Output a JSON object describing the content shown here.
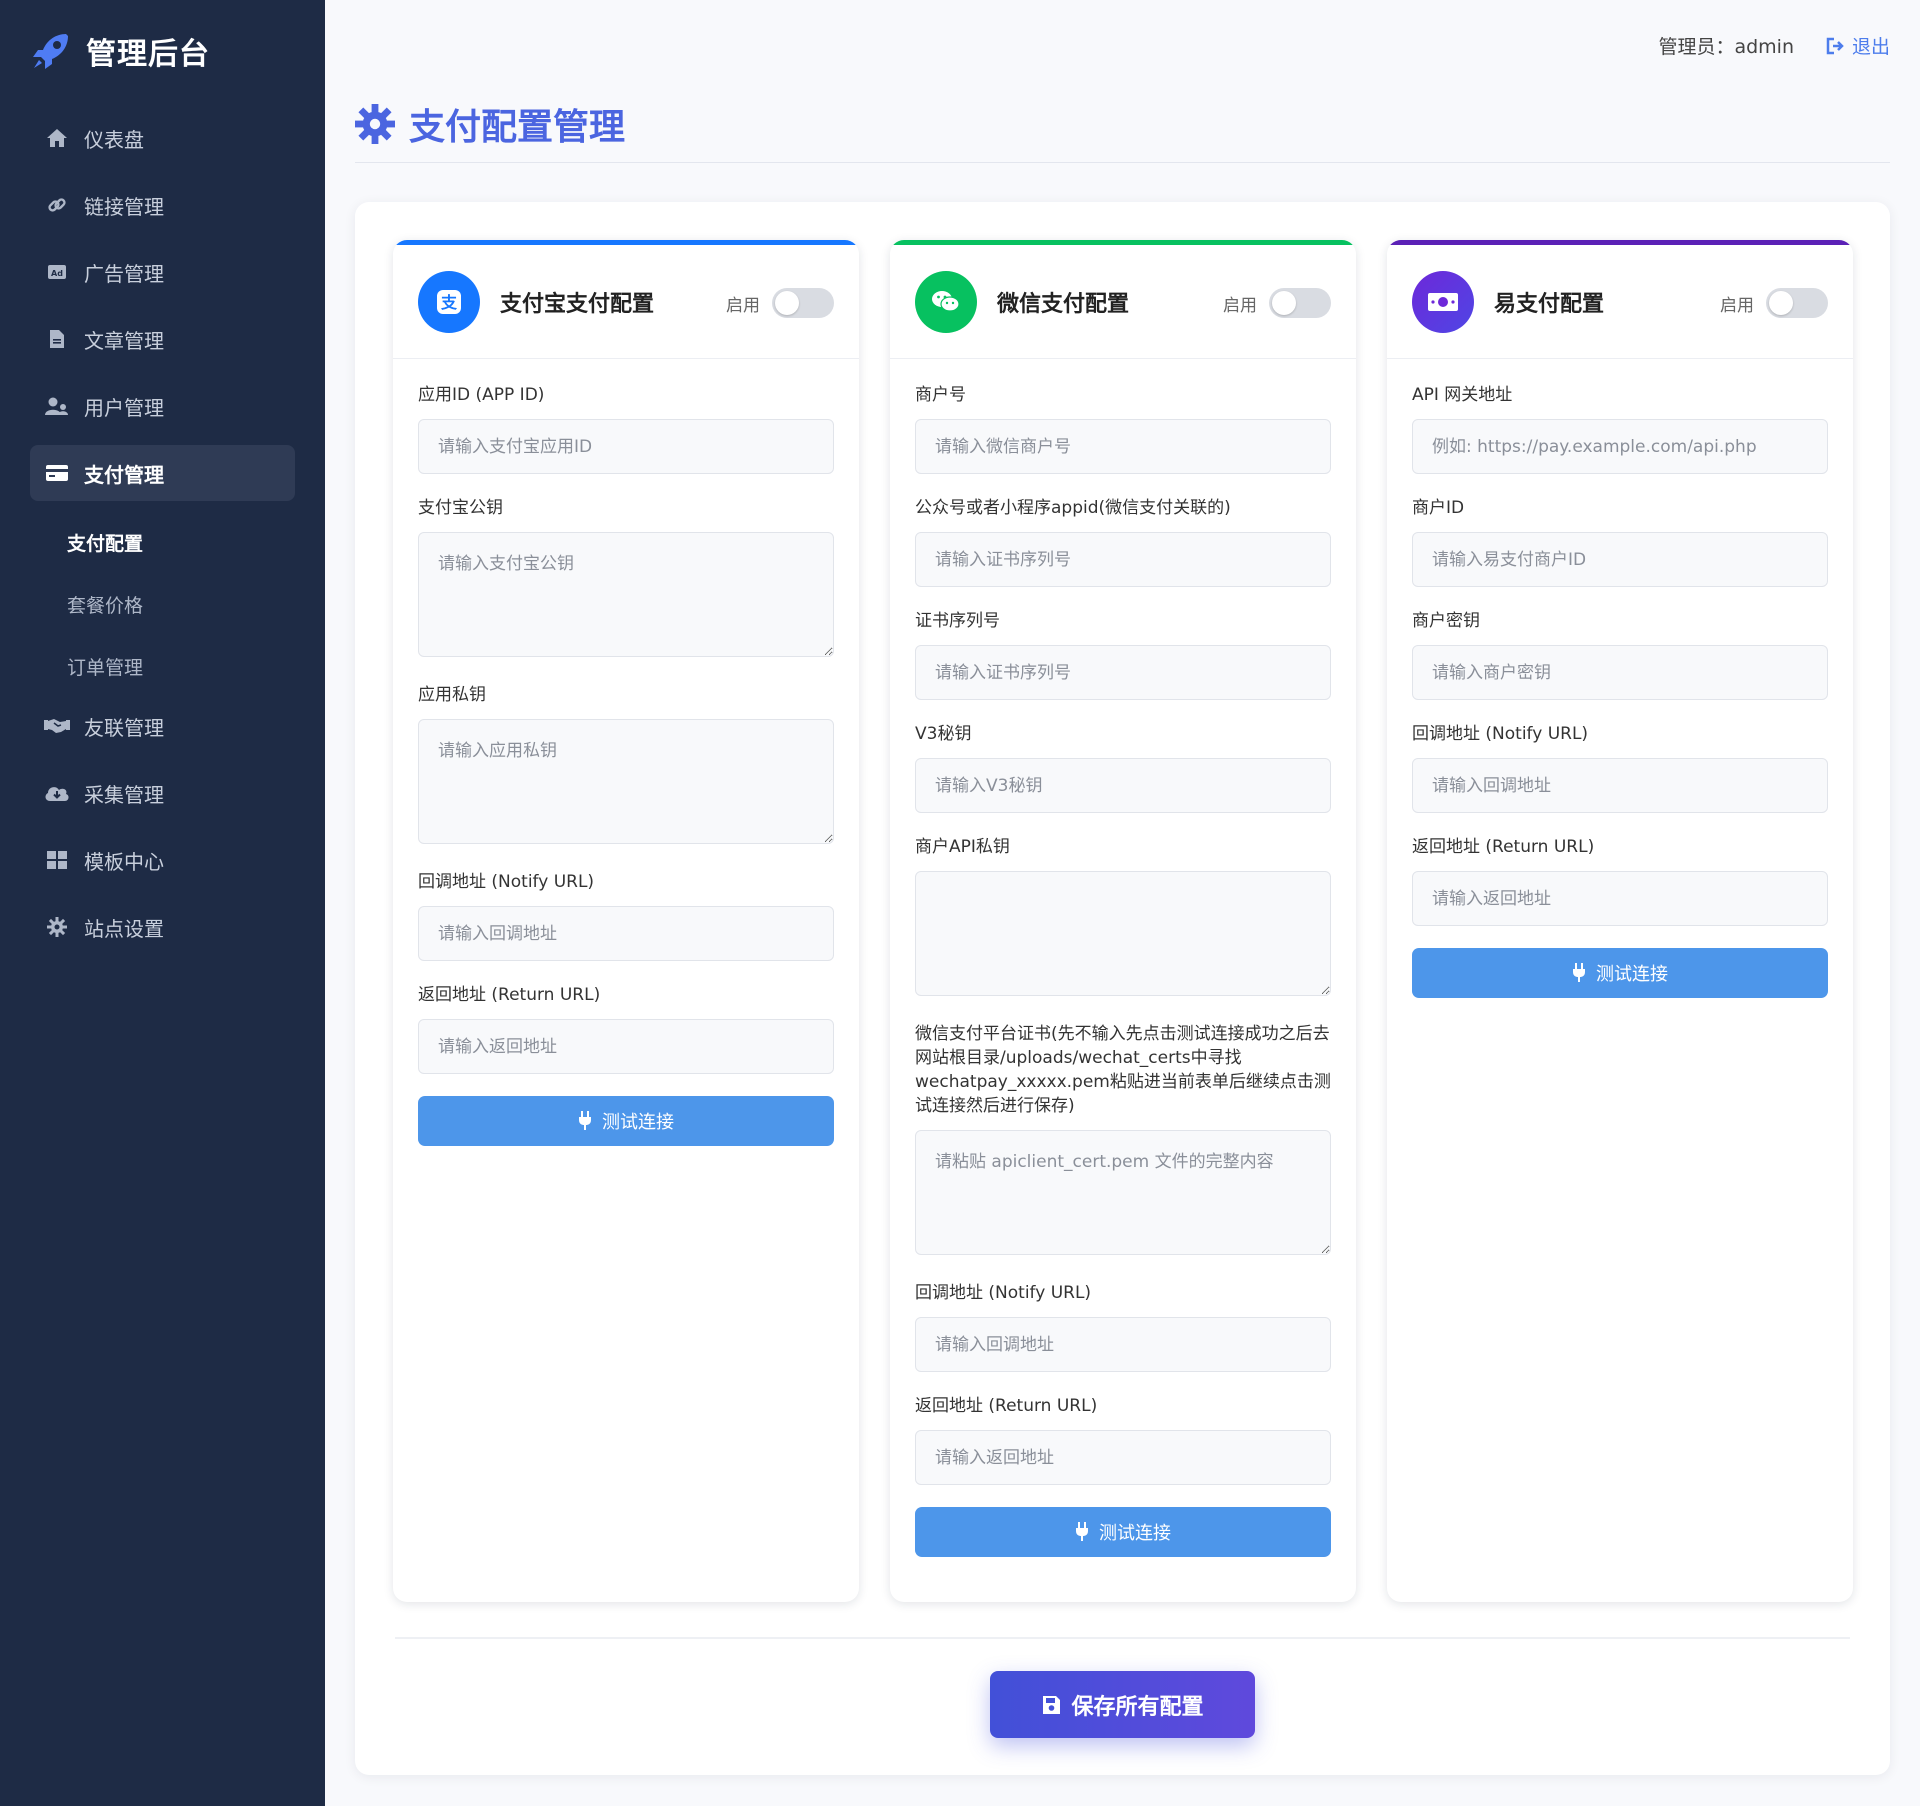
{
  "brand": {
    "title": "管理后台"
  },
  "sidebar": {
    "items": [
      {
        "label": "仪表盘",
        "icon": "home-icon"
      },
      {
        "label": "链接管理",
        "icon": "link-icon"
      },
      {
        "label": "广告管理",
        "icon": "ad-icon"
      },
      {
        "label": "文章管理",
        "icon": "file-icon"
      },
      {
        "label": "用户管理",
        "icon": "users-icon"
      },
      {
        "label": "支付管理",
        "icon": "credit-card-icon"
      },
      {
        "label": "友联管理",
        "icon": "handshake-icon"
      },
      {
        "label": "采集管理",
        "icon": "cloud-download-icon"
      },
      {
        "label": "模板中心",
        "icon": "grid-icon"
      },
      {
        "label": "站点设置",
        "icon": "gear-icon"
      }
    ],
    "sub_items": [
      {
        "label": "支付配置"
      },
      {
        "label": "套餐价格"
      },
      {
        "label": "订单管理"
      }
    ]
  },
  "header": {
    "user": "管理员：admin",
    "logout": "退出"
  },
  "page": {
    "title": "支付配置管理"
  },
  "cards": {
    "alipay": {
      "title": "支付宝支付配置",
      "toggle_label": "启用",
      "enabled": false,
      "accent": "#1677ff",
      "fields": [
        {
          "label": "应用ID (APP ID)",
          "placeholder": "请输入支付宝应用ID"
        },
        {
          "label": "支付宝公钥",
          "placeholder": "请输入支付宝公钥"
        },
        {
          "label": "应用私钥",
          "placeholder": "请输入应用私钥"
        },
        {
          "label": "回调地址 (Notify URL)",
          "placeholder": "请输入回调地址"
        },
        {
          "label": "返回地址 (Return URL)",
          "placeholder": "请输入返回地址"
        }
      ],
      "test_button": "测试连接"
    },
    "wechat": {
      "title": "微信支付配置",
      "toggle_label": "启用",
      "enabled": false,
      "accent": "#07c160",
      "fields": [
        {
          "label": "商户号",
          "placeholder": "请输入微信商户号"
        },
        {
          "label": "公众号或者小程序appid(微信支付关联的)",
          "placeholder": "请输入证书序列号"
        },
        {
          "label": "证书序列号",
          "placeholder": "请输入证书序列号"
        },
        {
          "label": "V3秘钥",
          "placeholder": "请输入V3秘钥"
        },
        {
          "label": "商户API私钥",
          "placeholder": ""
        },
        {
          "label": "微信支付平台证书(先不输入先点击测试连接成功之后去网站根目录/uploads/wechat_certs中寻找wechatpay_xxxxx.pem粘贴进当前表单后继续点击测试连接然后进行保存)",
          "placeholder": "请粘贴 apiclient_cert.pem 文件的完整内容"
        },
        {
          "label": "回调地址 (Notify URL)",
          "placeholder": "请输入回调地址"
        },
        {
          "label": "返回地址 (Return URL)",
          "placeholder": "请输入返回地址"
        }
      ],
      "test_button": "测试连接"
    },
    "epay": {
      "title": "易支付配置",
      "toggle_label": "启用",
      "enabled": false,
      "accent": "#5b21b6",
      "fields": [
        {
          "label": "API 网关地址",
          "placeholder": "例如: https://pay.example.com/api.php"
        },
        {
          "label": "商户ID",
          "placeholder": "请输入易支付商户ID"
        },
        {
          "label": "商户密钥",
          "placeholder": "请输入商户密钥"
        },
        {
          "label": "回调地址 (Notify URL)",
          "placeholder": "请输入回调地址"
        },
        {
          "label": "返回地址 (Return URL)",
          "placeholder": "请输入返回地址"
        }
      ],
      "test_button": "测试连接"
    }
  },
  "save_button": "保存所有配置",
  "colors": {
    "sidebar_bg": "#1e2b45",
    "title_blue": "#4b65e0",
    "test_button": "#4d96ea",
    "save_button": "#4250d8"
  }
}
